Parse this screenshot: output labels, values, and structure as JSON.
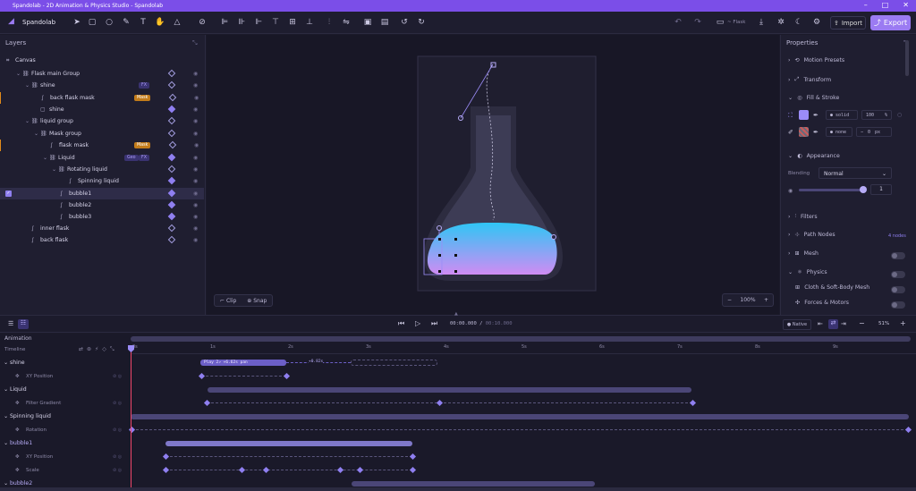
{
  "title": "Spandolab - 2D Animation & Physics Studio - Spandolab",
  "app": {
    "name": "Spandolab"
  },
  "toolbar": {
    "project": "Flask",
    "import_label": "Import",
    "export_label": "Export"
  },
  "layers": {
    "header": "Layers",
    "root": "Canvas",
    "rows": [
      {
        "label": "Flask main Group",
        "badges": []
      },
      {
        "label": "shine",
        "badges": [
          "FX"
        ]
      },
      {
        "label": "back flask mask",
        "badges": [
          "Mask"
        ]
      },
      {
        "label": "shine",
        "badges": []
      },
      {
        "label": "liquid group",
        "badges": []
      },
      {
        "label": "Mask group",
        "badges": []
      },
      {
        "label": "flask mask",
        "badges": [
          "Mask"
        ]
      },
      {
        "label": "Liquid",
        "badges": [
          "Geo",
          "FX"
        ]
      },
      {
        "label": "Rotating liquid",
        "badges": []
      },
      {
        "label": "Spinning liquid",
        "badges": []
      },
      {
        "label": "bubble1",
        "badges": []
      },
      {
        "label": "bubble2",
        "badges": []
      },
      {
        "label": "bubble3",
        "badges": []
      },
      {
        "label": "inner flask",
        "badges": []
      },
      {
        "label": "back flask",
        "badges": []
      }
    ]
  },
  "canvas": {
    "clip_label": "Clip",
    "snap_label": "Snap",
    "zoom": "100%"
  },
  "properties": {
    "header": "Properties",
    "motion_presets": "Motion Presets",
    "transform": "Transform",
    "fill_stroke": "Fill & Stroke",
    "fill_type": "solid",
    "fill_opacity": "100",
    "fill_unit": "%",
    "stroke_type": "none",
    "stroke_width": "0",
    "stroke_unit": "px",
    "appearance": "Appearance",
    "blending_label": "Blending",
    "blending_value": "Normal",
    "opacity_value": "1",
    "filters": "Filters",
    "path_nodes": "Path Nodes",
    "path_nodes_count": "4 nodes",
    "mesh": "Mesh",
    "physics": "Physics",
    "cloth": "Cloth & Soft-Body Mesh",
    "forces": "Forces & Motors",
    "fill_color": "#9b8cf7"
  },
  "transport": {
    "time_current": "00:00.000",
    "time_sep": "/",
    "time_total": "00:10.000",
    "native_label": "Native",
    "zoom": "51%"
  },
  "timeline": {
    "animation_label": "Animation",
    "timeline_label": "Timeline",
    "ticks": [
      "0s",
      "1s",
      "2s",
      "3s",
      "4s",
      "5s",
      "6s",
      "7s",
      "8s",
      "9s"
    ],
    "clip_label": "Play 2↗ +6.62s pan",
    "clip_label2": "+0.82s",
    "rows": [
      {
        "label": "shine",
        "type": "group"
      },
      {
        "label": "XY Position",
        "type": "prop"
      },
      {
        "label": "Liquid",
        "type": "group"
      },
      {
        "label": "Filter Gradient",
        "type": "prop"
      },
      {
        "label": "Spinning liquid",
        "type": "group"
      },
      {
        "label": "Rotation",
        "type": "prop"
      },
      {
        "label": "bubble1",
        "type": "group"
      },
      {
        "label": "XY Position",
        "type": "prop"
      },
      {
        "label": "Scale",
        "type": "prop"
      },
      {
        "label": "bubble2",
        "type": "group"
      }
    ]
  }
}
